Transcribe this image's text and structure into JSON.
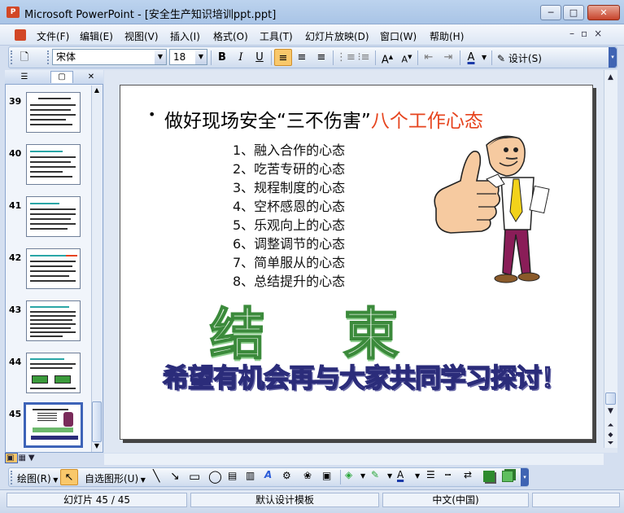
{
  "window": {
    "title": "Microsoft PowerPoint - [安全生产知识培训ppt.ppt]",
    "app_icon_text": "P",
    "controls": {
      "minimize": "─",
      "maximize": "□",
      "close": "✕"
    }
  },
  "menu": [
    "文件(F)",
    "编辑(E)",
    "视图(V)",
    "插入(I)",
    "格式(O)",
    "工具(T)",
    "幻灯片放映(D)",
    "窗口(W)",
    "帮助(H)"
  ],
  "menu_doc_controls": "–▫×",
  "format_toolbar": {
    "font_name": "宋体",
    "font_size": "18",
    "bold": "B",
    "italic": "I",
    "underline": "U",
    "design_label": "设计(S)",
    "font_color_label": "A"
  },
  "thumbnails": [
    {
      "num": "39"
    },
    {
      "num": "40"
    },
    {
      "num": "41"
    },
    {
      "num": "42"
    },
    {
      "num": "43"
    },
    {
      "num": "44"
    },
    {
      "num": "45",
      "selected": true
    }
  ],
  "slide": {
    "bullet": "•",
    "title_black": "做好现场安全“三不伤害”",
    "title_red": "八个工作心态",
    "items": [
      "1、融入合作的心态",
      "2、吃苦专研的心态",
      "3、规程制度的心态",
      "4、空杯感恩的心态",
      "5、乐观向上的心态",
      "6、调整调节的心态",
      "7、简单服从的心态",
      "8、总结提升的心态"
    ],
    "end_text": "结束",
    "thanks_text": "希望有机会再与大家共同学习探讨！"
  },
  "drawing_toolbar": {
    "draw_label": "绘图(R)",
    "autoshapes_label": "自选图形(U)"
  },
  "status": {
    "slide_count": "幻灯片 45 / 45",
    "template": "默认设计模板",
    "language": "中文(中国)"
  },
  "colors": {
    "accent_red": "#e6441e",
    "selection_border": "#3d63b8",
    "end_green": "#3b8a3b"
  }
}
